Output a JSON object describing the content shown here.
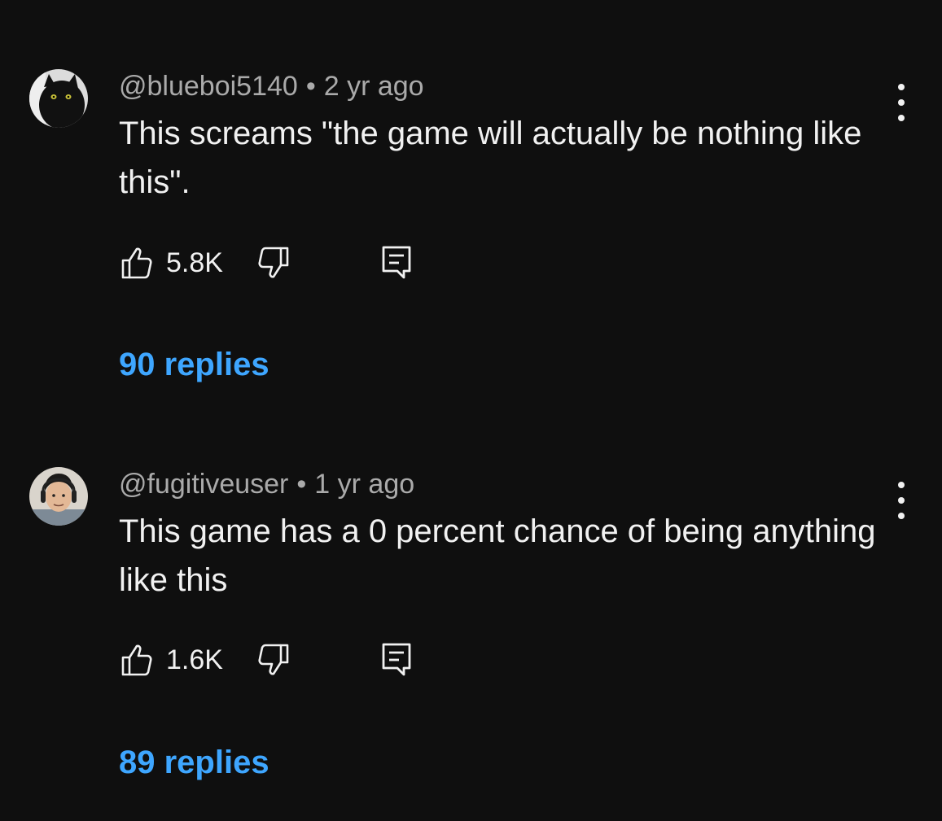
{
  "comments": [
    {
      "handle": "@blueboi5140",
      "separator": "•",
      "time": "2 yr ago",
      "text": "This screams \"the game will actually be nothing like this\".",
      "likes": "5.8K",
      "replies": "90 replies",
      "avatar_icon": "black-cat-avatar"
    },
    {
      "handle": "@fugitiveuser",
      "separator": "•",
      "time": "1 yr ago",
      "text": "This game has a 0 percent chance of being anything like this",
      "likes": "1.6K",
      "replies": "89 replies",
      "avatar_icon": "person-with-headphones-avatar"
    }
  ],
  "colors": {
    "background": "#0f0f0f",
    "text": "#f1f1f1",
    "meta": "#aaaaaa",
    "link": "#3ea6ff"
  }
}
